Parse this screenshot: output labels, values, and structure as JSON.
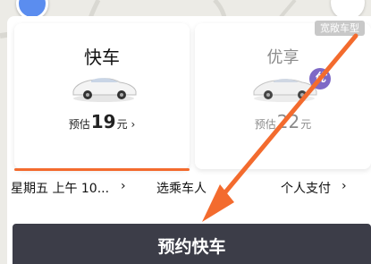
{
  "cards": {
    "express": {
      "name": "快车",
      "price_prefix": "预估",
      "price_value": "19",
      "price_suffix": "元",
      "chevron": "›",
      "selected": true
    },
    "comfort": {
      "name": "优享",
      "price_prefix": "预估",
      "price_value": "22",
      "price_suffix": "元",
      "badge": "优",
      "selected": false
    }
  },
  "chip": {
    "wide_car": "宽敞车型"
  },
  "options": {
    "time": "星期五 上午 10...",
    "time_chevron": "›",
    "passenger": "选乘车人",
    "payment": "个人支付",
    "payment_chevron": "›"
  },
  "cta": {
    "book": "预约快车"
  },
  "colors": {
    "accent_orange": "#f36b2e",
    "cta_dark": "#3c3d48",
    "badge_purple": "#7e69c6"
  },
  "icons": {
    "car": "car-icon",
    "location": "location-dot-icon",
    "arrow": "arrow-annotation-icon"
  }
}
